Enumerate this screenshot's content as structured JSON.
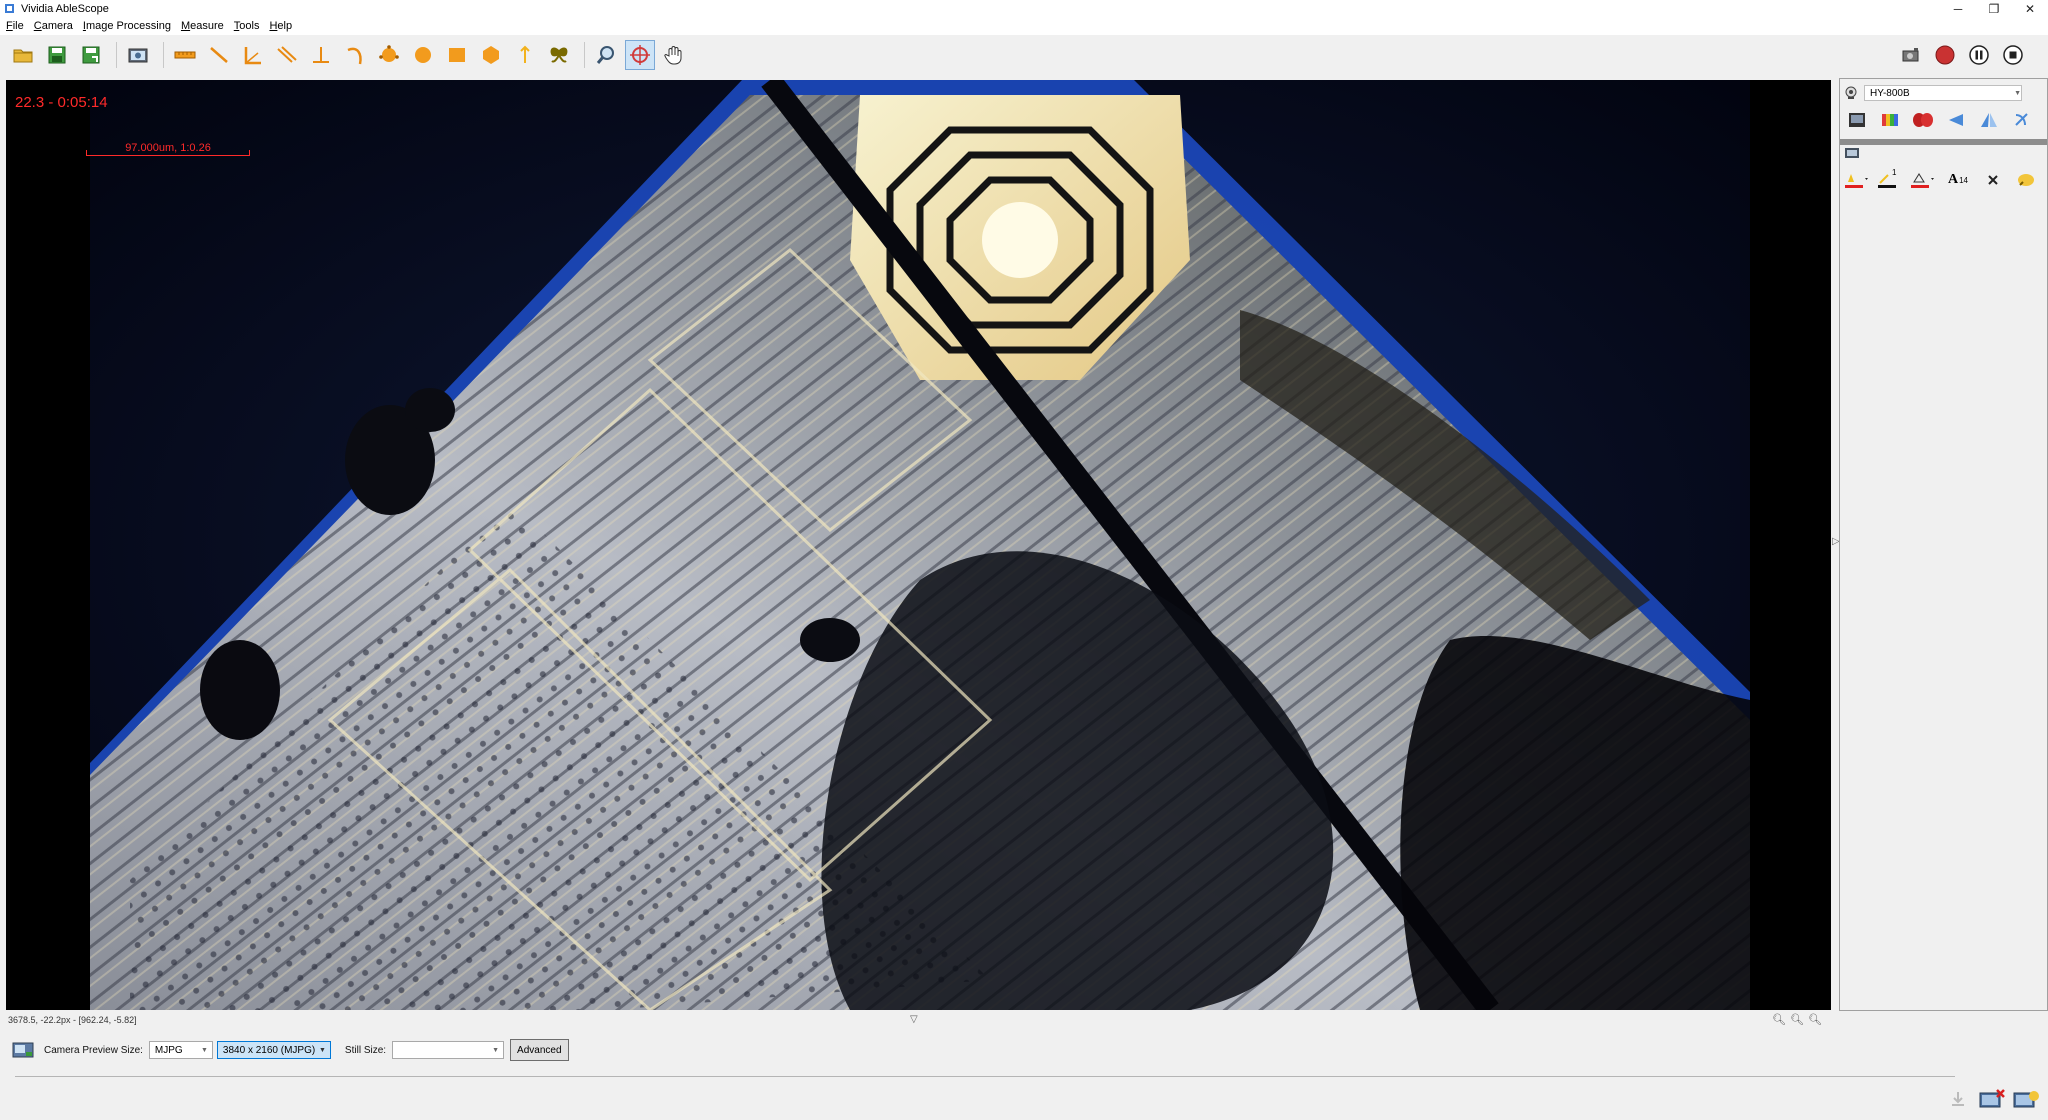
{
  "window": {
    "title": "Vividia AbleScope",
    "minimize_glyph": "─",
    "restore_glyph": "❐",
    "close_glyph": "✕"
  },
  "menu": [
    {
      "prefix": "",
      "accel": "F",
      "rest": "ile"
    },
    {
      "prefix": "",
      "accel": "C",
      "rest": "amera"
    },
    {
      "prefix": "",
      "accel": "I",
      "rest": "mage Processing"
    },
    {
      "prefix": "",
      "accel": "M",
      "rest": "easure"
    },
    {
      "prefix": "",
      "accel": "T",
      "rest": "ools"
    },
    {
      "prefix": "",
      "accel": "H",
      "rest": "elp"
    }
  ],
  "toolbar": {
    "icons": [
      "open-folder-icon",
      "save-icon",
      "save-as-icon",
      "snapshot-icon",
      "ruler-icon",
      "line-icon",
      "angle-icon",
      "parallel-lines-icon",
      "perpendicular-icon",
      "arc-icon",
      "circle-3pt-icon",
      "circle-icon",
      "rectangle-icon",
      "polygon-icon",
      "point-icon",
      "butterfly-icon",
      "zoom-icon",
      "crosshair-icon",
      "hand-pan-icon"
    ],
    "active": "crosshair-icon",
    "right_icons": [
      "camera-settings-icon",
      "record-icon",
      "pause-icon",
      "stop-icon"
    ]
  },
  "viewer": {
    "overlay_time": "22.3 - 0:05:14",
    "scale_label": "97.000um, 1:0.26"
  },
  "right_panel": {
    "camera_name": "HY-800B",
    "row1_icons": [
      "image-adjust-icon",
      "color-icon",
      "white-balance-icon",
      "flip-horizontal-icon",
      "flip-vertical-icon",
      "rotate-icon"
    ],
    "row2_icons": [
      "pen-color-icon",
      "line-width-icon",
      "fill-color-icon",
      "font-size-icon",
      "clear-icon",
      "highlight-icon"
    ],
    "line_width": "1",
    "font_size": "14",
    "font_letter": "A"
  },
  "status": {
    "coords": "3678.5, -22.2px - [962.24, -5.82]"
  },
  "bottom": {
    "preview_label": "Camera Preview Size:",
    "format": "MJPG",
    "resolution": "3840 x 2160 (MJPG)",
    "still_label": "Still Size:",
    "still_value": "",
    "advanced": "Advanced"
  },
  "colors": {
    "overlay_red": "#ff2a2a",
    "accent": "#0078d7"
  }
}
